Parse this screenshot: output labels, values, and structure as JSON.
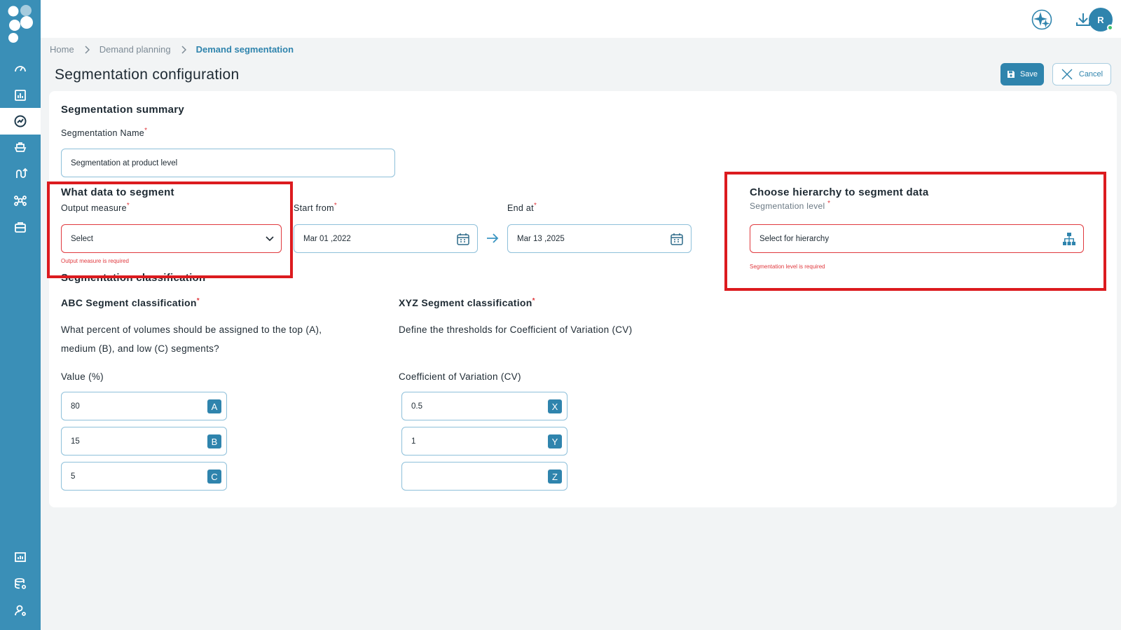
{
  "breadcrumb": {
    "items": [
      "Home",
      "Demand planning"
    ],
    "current": "Demand segmentation"
  },
  "page": {
    "title": "Segmentation configuration"
  },
  "actions": {
    "save_label": "Save",
    "cancel_label": "Cancel"
  },
  "user": {
    "initial": "R"
  },
  "summary": {
    "heading": "Segmentation summary",
    "name_label": "Segmentation Name",
    "name_value": "Segmentation at product level"
  },
  "what_data": {
    "heading": "What data to segment",
    "output_label": "Output measure",
    "output_value": "Select",
    "output_error": "Output measure is required",
    "start_label": "Start from",
    "start_value": "Mar 01 ,2022",
    "end_label": "End at",
    "end_value": "Mar 13 ,2025"
  },
  "hierarchy": {
    "heading": "Choose hierarchy to segment data",
    "level_label": "Segmentation level",
    "level_placeholder": "Select for hierarchy",
    "level_error": "Segmentation level is required"
  },
  "classification": {
    "heading": "Segmentation classification",
    "abc": {
      "heading": "ABC Segment classification",
      "question_line1": "What percent of volumes should be assigned to the top (A),",
      "question_line2": "medium (B), and low (C) segments?",
      "value_label": "Value (%)",
      "rows": [
        {
          "value": "80",
          "badge": "A"
        },
        {
          "value": "15",
          "badge": "B"
        },
        {
          "value": "5",
          "badge": "C"
        }
      ]
    },
    "xyz": {
      "heading": "XYZ Segment classification",
      "question": "Define the thresholds for Coefficient of Variation (CV)",
      "value_label": "Coefficient of Variation (CV)",
      "rows": [
        {
          "value": "0.5",
          "badge": "X"
        },
        {
          "value": "1",
          "badge": "Y"
        },
        {
          "value": "",
          "badge": "Z"
        }
      ]
    }
  },
  "colors": {
    "sidebar": "#3a8fb7",
    "accent": "#2f84ad",
    "error": "#e0393e",
    "highlight": "#dc1b1f"
  }
}
